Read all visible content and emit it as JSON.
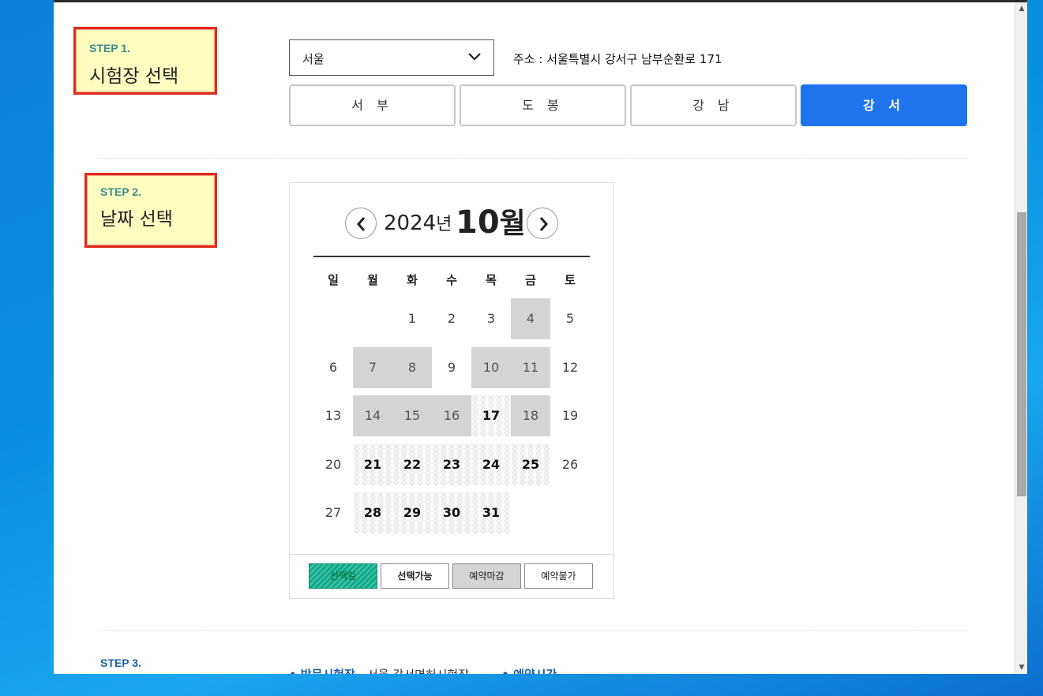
{
  "step1": {
    "label": "STEP 1.",
    "title": "시험장 선택"
  },
  "region": {
    "value": "서울",
    "address": "주소 : 서울특별시 강서구 남부순환로 171"
  },
  "centers": [
    {
      "label": "서 부",
      "active": false
    },
    {
      "label": "도 봉",
      "active": false
    },
    {
      "label": "강 남",
      "active": false
    },
    {
      "label": "강 서",
      "active": true
    }
  ],
  "step2": {
    "label": "STEP 2.",
    "title": "날짜 선택"
  },
  "calendar": {
    "year": "2024",
    "year_unit": "년",
    "month": "10",
    "month_unit": "월",
    "weekdays": [
      "일",
      "월",
      "화",
      "수",
      "목",
      "금",
      "토"
    ],
    "weeks": [
      [
        null,
        null,
        {
          "d": "1",
          "s": "normal"
        },
        {
          "d": "2",
          "s": "normal"
        },
        {
          "d": "3",
          "s": "normal"
        },
        {
          "d": "4",
          "s": "closed"
        },
        {
          "d": "5",
          "s": "normal"
        }
      ],
      [
        {
          "d": "6",
          "s": "normal"
        },
        {
          "d": "7",
          "s": "closed"
        },
        {
          "d": "8",
          "s": "closed"
        },
        {
          "d": "9",
          "s": "normal"
        },
        {
          "d": "10",
          "s": "closed"
        },
        {
          "d": "11",
          "s": "closed"
        },
        {
          "d": "12",
          "s": "normal"
        }
      ],
      [
        {
          "d": "13",
          "s": "normal"
        },
        {
          "d": "14",
          "s": "closed"
        },
        {
          "d": "15",
          "s": "closed"
        },
        {
          "d": "16",
          "s": "closed"
        },
        {
          "d": "17",
          "s": "avail"
        },
        {
          "d": "18",
          "s": "closed"
        },
        {
          "d": "19",
          "s": "normal"
        }
      ],
      [
        {
          "d": "20",
          "s": "normal"
        },
        {
          "d": "21",
          "s": "avail"
        },
        {
          "d": "22",
          "s": "avail"
        },
        {
          "d": "23",
          "s": "avail"
        },
        {
          "d": "24",
          "s": "avail"
        },
        {
          "d": "25",
          "s": "avail"
        },
        {
          "d": "26",
          "s": "normal"
        }
      ],
      [
        {
          "d": "27",
          "s": "normal"
        },
        {
          "d": "28",
          "s": "avail"
        },
        {
          "d": "29",
          "s": "avail"
        },
        {
          "d": "30",
          "s": "avail"
        },
        {
          "d": "31",
          "s": "avail"
        },
        null,
        null
      ]
    ],
    "legend": {
      "selected": "선택일",
      "available": "선택가능",
      "closed": "예약마감",
      "unavailable": "예약불가"
    }
  },
  "step3": {
    "label": "STEP 3.",
    "visit_label": "• 방문시험장",
    "visit_value": "서울 강서면허시험장",
    "time_label": "• 예약시간"
  }
}
